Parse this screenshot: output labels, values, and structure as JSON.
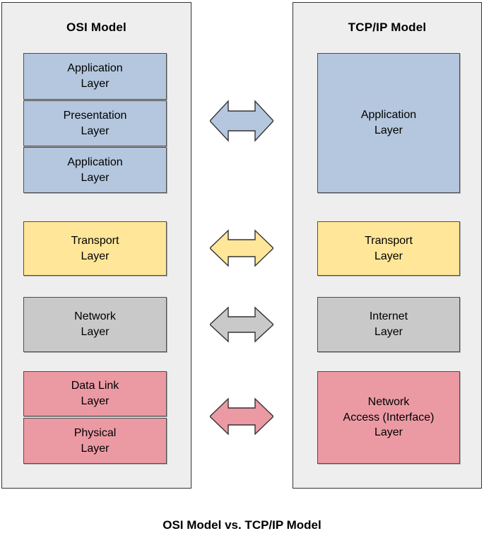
{
  "caption": "OSI Model vs. TCP/IP Model",
  "osi": {
    "title": "OSI Model",
    "layers": [
      {
        "name": "Application Layer",
        "label": "Application\nLayer",
        "color": "#b4c7de"
      },
      {
        "name": "Presentation Layer",
        "label": "Presentation\nLayer",
        "color": "#b4c7de"
      },
      {
        "name": "Application Layer",
        "label": "Application\nLayer",
        "color": "#b4c7de"
      },
      {
        "name": "Transport Layer",
        "label": "Transport\nLayer",
        "color": "#ffe699"
      },
      {
        "name": "Network Layer",
        "label": "Network\nLayer",
        "color": "#c9c9c9"
      },
      {
        "name": "Data Link Layer",
        "label": "Data Link\nLayer",
        "color": "#eb9aa4"
      },
      {
        "name": "Physical Layer",
        "label": "Physical\nLayer",
        "color": "#eb9aa4"
      }
    ]
  },
  "tcpip": {
    "title": "TCP/IP Model",
    "layers": [
      {
        "name": "Application Layer",
        "label": "Application\nLayer",
        "color": "#b4c7de"
      },
      {
        "name": "Transport Layer",
        "label": "Transport\nLayer",
        "color": "#ffe699"
      },
      {
        "name": "Internet Layer",
        "label": "Internet\nLayer",
        "color": "#c9c9c9"
      },
      {
        "name": "Network Access (Interface) Layer",
        "label": "Network\nAccess (Interface)\nLayer",
        "color": "#eb9aa4"
      }
    ]
  },
  "mappings": [
    {
      "from": "Application, Presentation, Application Layers",
      "to": "Application Layer",
      "color": "#b4c7de"
    },
    {
      "from": "Transport Layer",
      "to": "Transport Layer",
      "color": "#ffe699"
    },
    {
      "from": "Network Layer",
      "to": "Internet Layer",
      "color": "#c9c9c9"
    },
    {
      "from": "Data Link, Physical Layers",
      "to": "Network Access (Interface) Layer",
      "color": "#eb9aa4"
    }
  ],
  "colors": {
    "panel_background": "#eeeeee",
    "panel_border": "#333333",
    "box_border": "#4d4d4d",
    "arrow_border": "#333333",
    "page_background": "#ffffff",
    "text": "#000000"
  }
}
